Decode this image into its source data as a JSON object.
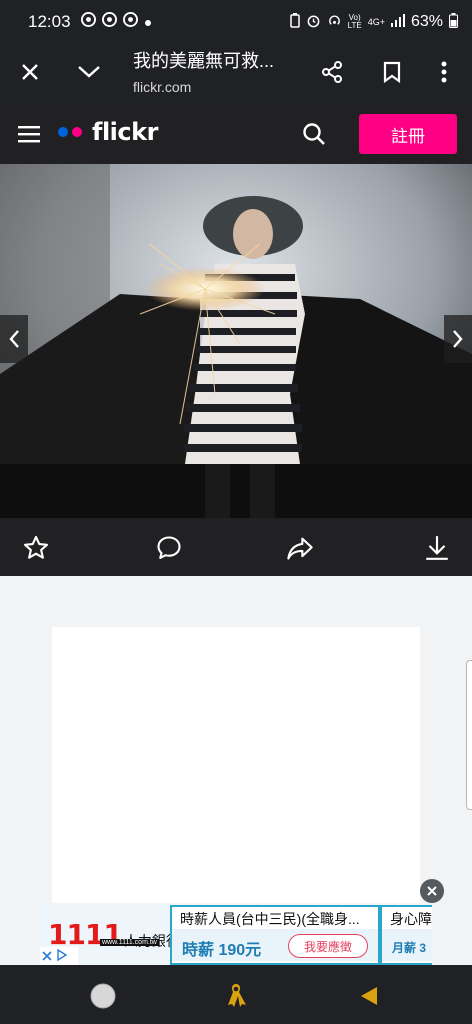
{
  "status_bar": {
    "time": "12:03",
    "left_icons": [
      "chrome-icon",
      "chrome-icon",
      "chrome-icon",
      "dot-icon"
    ],
    "battery": "63%",
    "signal_labels": [
      "Vo)",
      "LTE",
      "4G+"
    ]
  },
  "browser": {
    "page_title": "我的美麗無可救...",
    "url": "flickr.com"
  },
  "flickr": {
    "logo_text": "flickr",
    "signup_label": "註冊",
    "colors": {
      "blue": "#0063dc",
      "pink": "#ff0084"
    }
  },
  "ad": {
    "brand_number": "1111",
    "brand_name": "人力銀行",
    "brand_site": "www.1111.com.tw",
    "jobs": [
      {
        "title": "時薪人員(台中三民)(全職身...",
        "pay": "時薪 190元",
        "apply": "我要應徵"
      },
      {
        "title": "身心障",
        "pay": "月薪 3",
        "apply": ""
      }
    ]
  }
}
